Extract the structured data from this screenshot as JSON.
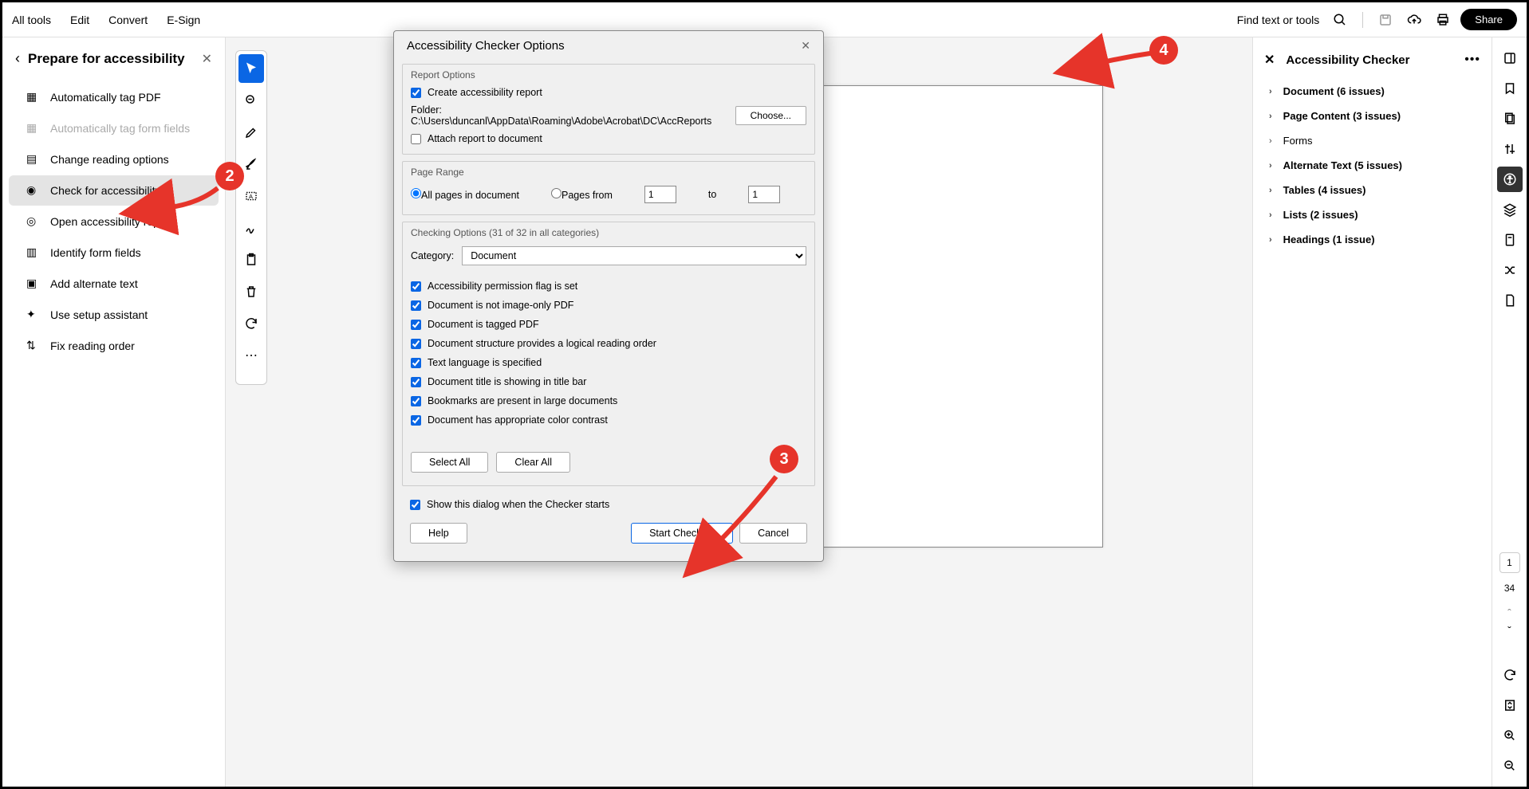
{
  "topbar": {
    "menus": [
      "All tools",
      "Edit",
      "Convert",
      "E-Sign"
    ],
    "find": "Find text or tools",
    "share": "Share"
  },
  "leftPanel": {
    "title": "Prepare for accessibility",
    "items": [
      {
        "label": "Automatically tag PDF",
        "disabled": false
      },
      {
        "label": "Automatically tag form fields",
        "disabled": true
      },
      {
        "label": "Change reading options",
        "disabled": false
      },
      {
        "label": "Check for accessibility",
        "disabled": false,
        "active": true
      },
      {
        "label": "Open accessibility report",
        "disabled": false
      },
      {
        "label": "Identify form fields",
        "disabled": false
      },
      {
        "label": "Add alternate text",
        "disabled": false
      },
      {
        "label": "Use setup assistant",
        "disabled": false
      },
      {
        "label": "Fix reading order",
        "disabled": false
      }
    ]
  },
  "checkerPanel": {
    "title": "Accessibility Checker",
    "items": [
      {
        "label": "Document (6 issues)",
        "bold": true
      },
      {
        "label": "Page Content (3 issues)",
        "bold": true
      },
      {
        "label": "Forms",
        "bold": false
      },
      {
        "label": "Alternate Text (5 issues)",
        "bold": true
      },
      {
        "label": "Tables (4 issues)",
        "bold": true
      },
      {
        "label": "Lists (2 issues)",
        "bold": true
      },
      {
        "label": "Headings (1 issue)",
        "bold": true
      }
    ]
  },
  "pageNav": {
    "current": "1",
    "total": "34"
  },
  "dialog": {
    "title": "Accessibility Checker Options",
    "reportOptions": {
      "legend": "Report Options",
      "createReport": "Create accessibility report",
      "folderLabel": "Folder:",
      "folderPath": "C:\\Users\\duncanl\\AppData\\Roaming\\Adobe\\Acrobat\\DC\\AccReports",
      "choose": "Choose...",
      "attach": "Attach report to document"
    },
    "pageRange": {
      "legend": "Page Range",
      "all": "All pages in document",
      "from": "Pages from",
      "to": "to",
      "fromVal": "1",
      "toVal": "1"
    },
    "checkingOptions": {
      "legend": "Checking Options (31 of 32 in all categories)",
      "categoryLabel": "Category:",
      "categorySelected": "Document",
      "checks": [
        "Accessibility permission flag is set",
        "Document is not image-only PDF",
        "Document is tagged PDF",
        "Document structure provides a logical reading order",
        "Text language is specified",
        "Document title is showing in title bar",
        "Bookmarks are present in large documents",
        "Document has appropriate color contrast"
      ],
      "selectAll": "Select All",
      "clearAll": "Clear All"
    },
    "showDialog": "Show this dialog when the Checker starts",
    "help": "Help",
    "start": "Start Checking",
    "cancel": "Cancel"
  },
  "callouts": {
    "c2": "2",
    "c3": "3",
    "c4": "4"
  }
}
